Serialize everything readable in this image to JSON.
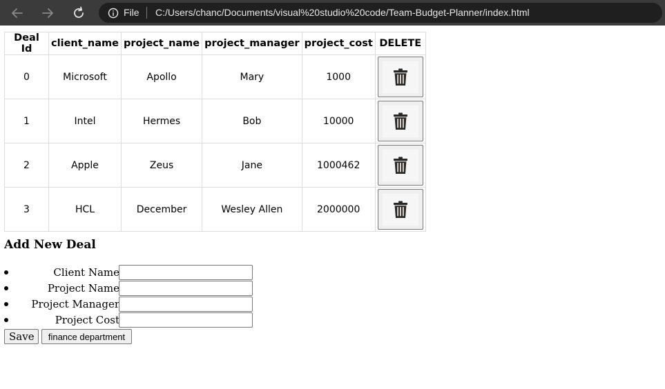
{
  "browser": {
    "nav": {
      "back_icon": "arrow-left-icon",
      "forward_icon": "arrow-right-icon",
      "reload_icon": "refresh-icon"
    },
    "address": {
      "info_icon": "info-icon",
      "scheme_label": "File",
      "url": "C:/Users/chanc/Documents/visual%20studio%20code/Team-Budget-Planner/index.html"
    }
  },
  "table": {
    "headers": [
      "Deal Id",
      "client_name",
      "project_name",
      "project_manager",
      "project_cost",
      "DELETE"
    ],
    "rows": [
      {
        "deal_id": "0",
        "client_name": "Microsoft",
        "project_name": "Apollo",
        "project_manager": "Mary",
        "project_cost": "1000",
        "delete_icon": "trash-icon"
      },
      {
        "deal_id": "1",
        "client_name": "Intel",
        "project_name": "Hermes",
        "project_manager": "Bob",
        "project_cost": "10000",
        "delete_icon": "trash-icon"
      },
      {
        "deal_id": "2",
        "client_name": "Apple",
        "project_name": "Zeus",
        "project_manager": "Jane",
        "project_cost": "1000462",
        "delete_icon": "trash-icon"
      },
      {
        "deal_id": "3",
        "client_name": "HCL",
        "project_name": "December",
        "project_manager": "Wesley Allen",
        "project_cost": "2000000",
        "delete_icon": "trash-icon"
      }
    ]
  },
  "form": {
    "title": "Add New Deal",
    "fields": [
      {
        "label": "Client Name",
        "value": ""
      },
      {
        "label": "Project Name",
        "value": ""
      },
      {
        "label": "Project Manager",
        "value": ""
      },
      {
        "label": "Project Cost",
        "value": ""
      }
    ],
    "save_label": "Save",
    "finance_label": "finance department"
  },
  "colors": {
    "chrome_bg": "#3b3b3b",
    "address_bg": "#1f1f1f",
    "table_border": "#dddddd"
  }
}
